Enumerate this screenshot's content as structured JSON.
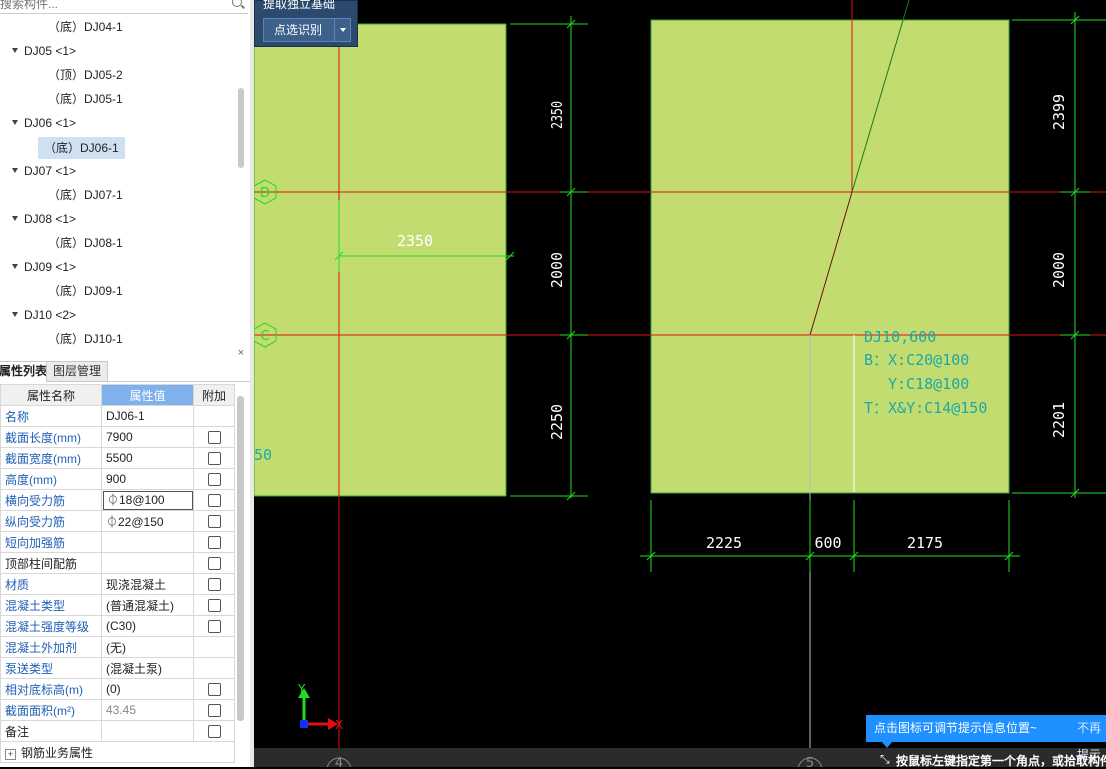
{
  "tree": {
    "search_placeholder": "搜索构件...",
    "nodes": [
      {
        "label": "（底）DJ04-1",
        "level": 2
      },
      {
        "label": "DJ05 <1>",
        "level": 1
      },
      {
        "label": "（顶）DJ05-2",
        "level": 2
      },
      {
        "label": "（底）DJ05-1",
        "level": 2
      },
      {
        "label": "DJ06 <1>",
        "level": 1
      },
      {
        "label": "（底）DJ06-1",
        "level": 2,
        "selected": true
      },
      {
        "label": "DJ07 <1>",
        "level": 1
      },
      {
        "label": "（底）DJ07-1",
        "level": 2
      },
      {
        "label": "DJ08 <1>",
        "level": 1
      },
      {
        "label": "（底）DJ08-1",
        "level": 2
      },
      {
        "label": "DJ09 <1>",
        "level": 1
      },
      {
        "label": "（底）DJ09-1",
        "level": 2
      },
      {
        "label": "DJ10 <2>",
        "level": 1
      },
      {
        "label": "（底）DJ10-1",
        "level": 2
      }
    ]
  },
  "props": {
    "tabs": [
      "属性列表",
      "图层管理"
    ],
    "close": "×",
    "headers": {
      "name": "属性名称",
      "value": "属性值",
      "extra": "附加"
    },
    "rows": [
      {
        "name": "名称",
        "value": "DJ06-1",
        "blue": true,
        "check": false
      },
      {
        "name": "截面长度(mm)",
        "value": "7900",
        "blue": true,
        "check": true
      },
      {
        "name": "截面宽度(mm)",
        "value": "5500",
        "blue": true,
        "check": true
      },
      {
        "name": "高度(mm)",
        "value": "900",
        "blue": true,
        "check": true
      },
      {
        "name": "横向受力筋",
        "value": "⏀18@100",
        "blue": true,
        "check": true,
        "editing": true
      },
      {
        "name": "纵向受力筋",
        "value": "⏀22@150",
        "blue": true,
        "check": true
      },
      {
        "name": "短向加强筋",
        "value": "",
        "blue": true,
        "check": true
      },
      {
        "name": "顶部柱间配筋",
        "value": "",
        "blue": false,
        "check": true
      },
      {
        "name": "材质",
        "value": "现浇混凝土",
        "blue": true,
        "check": true
      },
      {
        "name": "混凝土类型",
        "value": "(普通混凝土)",
        "blue": true,
        "check": true
      },
      {
        "name": "混凝土强度等级",
        "value": "(C30)",
        "blue": true,
        "check": true
      },
      {
        "name": "混凝土外加剂",
        "value": "(无)",
        "blue": true,
        "check": false
      },
      {
        "name": "泵送类型",
        "value": "(混凝土泵)",
        "blue": true,
        "check": false
      },
      {
        "name": "相对底标高(m)",
        "value": "(0)",
        "blue": true,
        "check": true
      },
      {
        "name": "截面面积(m²)",
        "value": "43.45",
        "blue": true,
        "check": true,
        "gray": true
      },
      {
        "name": "备注",
        "value": "",
        "blue": false,
        "check": true
      },
      {
        "name": "钢筋业务属性",
        "value": "",
        "blue": false,
        "check": false,
        "expander": true
      }
    ]
  },
  "toolbar": {
    "top_label": "提取独立基础",
    "button_label": "点选识别"
  },
  "cad": {
    "axis_labels": {
      "D": "D",
      "C": "C",
      "axis4": "4",
      "axis5": "5"
    },
    "dims": {
      "left_width": "2350",
      "left_h_top": "2350",
      "left_h_mid": "2000",
      "left_h_bot": "2250",
      "right_h_top": "2399",
      "right_h_mid": "2000",
      "right_h_bot": "2201",
      "bottom_1": "2225",
      "bottom_2": "600",
      "bottom_3": "2175",
      "left_partial": "50"
    },
    "annotation": [
      "DJ10,600",
      "B：X:C20@100",
      "Y:C18@100",
      "T：X&Y:C14@150"
    ],
    "ucs": {
      "x": "X",
      "y": "Y"
    },
    "colors": {
      "footing": "#c3dc70",
      "axis": "#e01010",
      "dim": "#22dd22",
      "text": "#1ea8a8"
    }
  },
  "status": {
    "tip": "点击图标可调节提示信息位置~",
    "tip_right": "不再提示",
    "message": "按鼠标左键指定第一个角点，或拾取构件图元"
  }
}
